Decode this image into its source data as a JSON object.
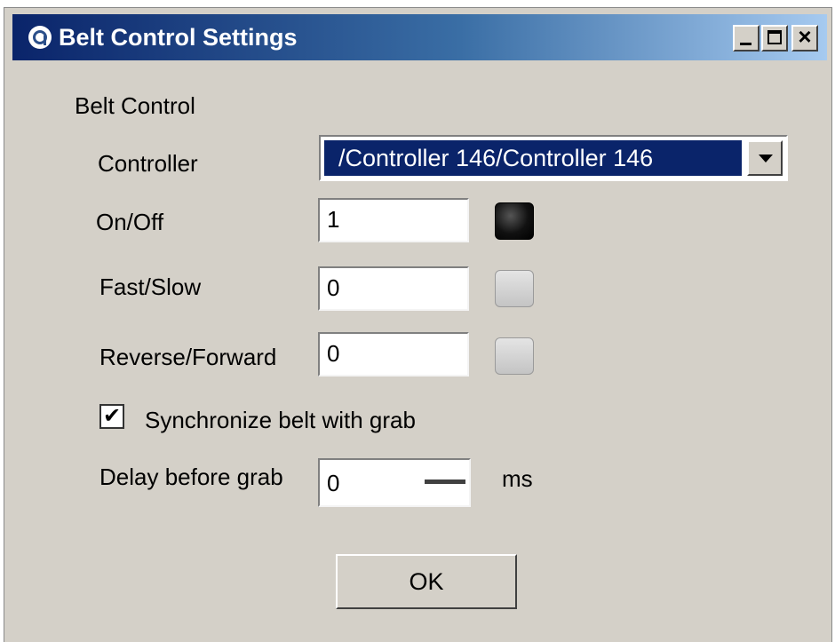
{
  "window": {
    "title": "Belt Control Settings",
    "controls": {
      "minimize": "minimize",
      "maximize": "maximize",
      "close": "×"
    }
  },
  "section": {
    "title": "Belt Control"
  },
  "controller": {
    "label": "Controller",
    "selected": "/Controller 146/Controller 146"
  },
  "fields": {
    "on_off": {
      "label": "On/Off",
      "value": "1",
      "indicator": "on"
    },
    "fast_slow": {
      "label": "Fast/Slow",
      "value": "0",
      "indicator": "off"
    },
    "reverse_forward": {
      "label": "Reverse/Forward",
      "value": "0",
      "indicator": "off"
    }
  },
  "sync": {
    "label": "Synchronize belt with grab",
    "checked": true,
    "mark": "✔"
  },
  "delay": {
    "label": "Delay before grab",
    "value": "0",
    "unit": "ms"
  },
  "ok_button": {
    "label": "OK"
  },
  "colors": {
    "window_bg": "#d4d0c8",
    "titlebar_start": "#0a246a",
    "titlebar_end": "#a6caf0",
    "selection_bg": "#0a246a",
    "indicator_on": "#000000",
    "indicator_off": "#c8c8c8"
  }
}
